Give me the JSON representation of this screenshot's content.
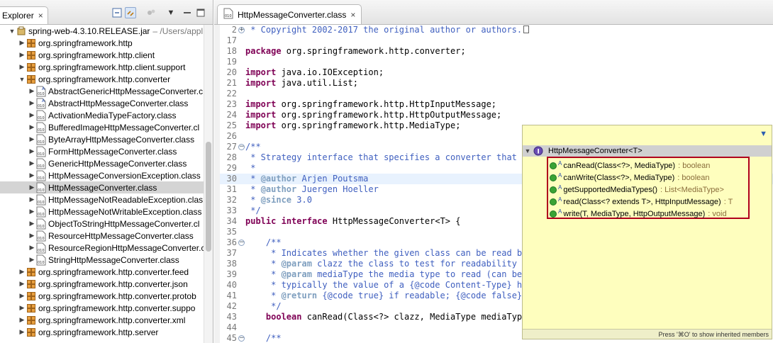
{
  "explorer": {
    "tab_label": "Explorer",
    "close_icon": "×",
    "items": [
      {
        "label": "spring-web-4.3.10.RELEASE.jar",
        "sub": "– /Users/appl",
        "kind": "jar",
        "indent": 1,
        "expanded": true
      },
      {
        "label": "org.springframework.http",
        "kind": "package",
        "indent": 2,
        "expanded": false
      },
      {
        "label": "org.springframework.http.client",
        "kind": "package",
        "indent": 2,
        "expanded": false
      },
      {
        "label": "org.springframework.http.client.support",
        "kind": "package",
        "indent": 2,
        "expanded": false
      },
      {
        "label": "org.springframework.http.converter",
        "kind": "package",
        "indent": 2,
        "expanded": true
      },
      {
        "label": "AbstractGenericHttpMessageConverter.c",
        "kind": "abstract-class",
        "indent": 3,
        "expanded": false
      },
      {
        "label": "AbstractHttpMessageConverter.class",
        "kind": "abstract-class",
        "indent": 3,
        "expanded": false
      },
      {
        "label": "ActivationMediaTypeFactory.class",
        "kind": "class",
        "indent": 3,
        "expanded": false
      },
      {
        "label": "BufferedImageHttpMessageConverter.cl",
        "kind": "class",
        "indent": 3,
        "expanded": false
      },
      {
        "label": "ByteArrayHttpMessageConverter.class",
        "kind": "class",
        "indent": 3,
        "expanded": false
      },
      {
        "label": "FormHttpMessageConverter.class",
        "kind": "class",
        "indent": 3,
        "expanded": false
      },
      {
        "label": "GenericHttpMessageConverter.class",
        "kind": "class",
        "indent": 3,
        "expanded": false
      },
      {
        "label": "HttpMessageConversionException.class",
        "kind": "class",
        "indent": 3,
        "expanded": false
      },
      {
        "label": "HttpMessageConverter.class",
        "kind": "class",
        "indent": 3,
        "expanded": false,
        "selected": true
      },
      {
        "label": "HttpMessageNotReadableException.clas",
        "kind": "class",
        "indent": 3,
        "expanded": false
      },
      {
        "label": "HttpMessageNotWritableException.class",
        "kind": "class",
        "indent": 3,
        "expanded": false
      },
      {
        "label": "ObjectToStringHttpMessageConverter.cl",
        "kind": "class",
        "indent": 3,
        "expanded": false
      },
      {
        "label": "ResourceHttpMessageConverter.class",
        "kind": "class",
        "indent": 3,
        "expanded": false
      },
      {
        "label": "ResourceRegionHttpMessageConverter.c",
        "kind": "class",
        "indent": 3,
        "expanded": false
      },
      {
        "label": "StringHttpMessageConverter.class",
        "kind": "class",
        "indent": 3,
        "expanded": false
      },
      {
        "label": "org.springframework.http.converter.feed",
        "kind": "package",
        "indent": 2,
        "expanded": false
      },
      {
        "label": "org.springframework.http.converter.json",
        "kind": "package",
        "indent": 2,
        "expanded": false
      },
      {
        "label": "org.springframework.http.converter.protob",
        "kind": "package",
        "indent": 2,
        "expanded": false
      },
      {
        "label": "org.springframework.http.converter.suppo",
        "kind": "package",
        "indent": 2,
        "expanded": false
      },
      {
        "label": "org.springframework.http.converter.xml",
        "kind": "package",
        "indent": 2,
        "expanded": false
      },
      {
        "label": "org.springframework.http.server",
        "kind": "package",
        "indent": 2,
        "expanded": false
      }
    ]
  },
  "editor": {
    "tab_label": "HttpMessageConverter.class",
    "close_icon": "×",
    "lines": [
      {
        "n": "2",
        "fold": "+",
        "segs": [
          {
            "t": " * Copyright 2002-2017 the original author or authors.",
            "c": "cm"
          }
        ],
        "box": true
      },
      {
        "n": "17",
        "segs": []
      },
      {
        "n": "18",
        "segs": [
          {
            "t": "package",
            "c": "kw"
          },
          {
            "t": " org.springframework.http.converter;"
          }
        ]
      },
      {
        "n": "19",
        "segs": []
      },
      {
        "n": "20",
        "segs": [
          {
            "t": "import",
            "c": "kw"
          },
          {
            "t": " java.io.IOException;"
          }
        ]
      },
      {
        "n": "21",
        "segs": [
          {
            "t": "import",
            "c": "kw"
          },
          {
            "t": " java.util.List;"
          }
        ]
      },
      {
        "n": "22",
        "segs": []
      },
      {
        "n": "23",
        "segs": [
          {
            "t": "import",
            "c": "kw"
          },
          {
            "t": " org.springframework.http.HttpInputMessage;"
          }
        ]
      },
      {
        "n": "24",
        "segs": [
          {
            "t": "import",
            "c": "kw"
          },
          {
            "t": " org.springframework.http.HttpOutputMessage;"
          }
        ]
      },
      {
        "n": "25",
        "segs": [
          {
            "t": "import",
            "c": "kw"
          },
          {
            "t": " org.springframework.http.MediaType;"
          }
        ]
      },
      {
        "n": "26",
        "segs": []
      },
      {
        "n": "27",
        "fold": "−",
        "segs": [
          {
            "t": "/**",
            "c": "cm"
          }
        ]
      },
      {
        "n": "28",
        "segs": [
          {
            "t": " * Strategy interface that specifies a converter that ca",
            "c": "cm"
          }
        ]
      },
      {
        "n": "29",
        "segs": [
          {
            "t": " *",
            "c": "cm"
          }
        ]
      },
      {
        "n": "30",
        "hl": true,
        "segs": [
          {
            "t": " * ",
            "c": "cm"
          },
          {
            "t": "@author",
            "c": "tag"
          },
          {
            "t": " Arjen Poutsma",
            "c": "cm"
          }
        ]
      },
      {
        "n": "31",
        "segs": [
          {
            "t": " * ",
            "c": "cm"
          },
          {
            "t": "@author",
            "c": "tag"
          },
          {
            "t": " Juergen Hoeller",
            "c": "cm"
          }
        ]
      },
      {
        "n": "32",
        "segs": [
          {
            "t": " * ",
            "c": "cm"
          },
          {
            "t": "@since",
            "c": "tag"
          },
          {
            "t": " 3.0",
            "c": "cm"
          }
        ]
      },
      {
        "n": "33",
        "segs": [
          {
            "t": " */",
            "c": "cm"
          }
        ]
      },
      {
        "n": "34",
        "segs": [
          {
            "t": "public",
            "c": "kw"
          },
          {
            "t": " "
          },
          {
            "t": "interface",
            "c": "kw"
          },
          {
            "t": " HttpMessageConverter<T> {"
          }
        ]
      },
      {
        "n": "35",
        "segs": []
      },
      {
        "n": "36",
        "fold": "−",
        "segs": [
          {
            "t": "    /**",
            "c": "cm"
          }
        ]
      },
      {
        "n": "37",
        "segs": [
          {
            "t": "     * Indicates whether the given class can be read by",
            "c": "cm"
          }
        ]
      },
      {
        "n": "38",
        "segs": [
          {
            "t": "     * ",
            "c": "cm"
          },
          {
            "t": "@param",
            "c": "tag"
          },
          {
            "t": " clazz the class to test for readability",
            "c": "cm"
          }
        ]
      },
      {
        "n": "39",
        "segs": [
          {
            "t": "     * ",
            "c": "cm"
          },
          {
            "t": "@param",
            "c": "tag"
          },
          {
            "t": " mediaType the media type to read (can be {",
            "c": "cm"
          }
        ]
      },
      {
        "n": "40",
        "segs": [
          {
            "t": "     * typically the value of a {@code Content-Type} hea",
            "c": "cm"
          }
        ]
      },
      {
        "n": "41",
        "segs": [
          {
            "t": "     * ",
            "c": "cm"
          },
          {
            "t": "@return",
            "c": "tag"
          },
          {
            "t": " {@code true} if readable; {@code false} o",
            "c": "cm"
          }
        ]
      },
      {
        "n": "42",
        "segs": [
          {
            "t": "     */",
            "c": "cm"
          }
        ]
      },
      {
        "n": "43",
        "segs": [
          {
            "t": "    "
          },
          {
            "t": "boolean",
            "c": "kw"
          },
          {
            "t": " canRead(Class<?> clazz, MediaType mediaType);"
          }
        ]
      },
      {
        "n": "44",
        "segs": []
      },
      {
        "n": "45",
        "fold": "−",
        "segs": [
          {
            "t": "    /**",
            "c": "cm"
          }
        ]
      }
    ]
  },
  "outline": {
    "menu_icon": "▼",
    "header": "HttpMessageConverter<T>",
    "items": [
      {
        "name": "canRead(Class<?>, MediaType)",
        "ret": ": boolean",
        "abstract": "A"
      },
      {
        "name": "canWrite(Class<?>, MediaType)",
        "ret": ": boolean",
        "abstract": "A"
      },
      {
        "name": "getSupportedMediaTypes()",
        "ret": ": List<MediaType>",
        "abstract": "A"
      },
      {
        "name": "read(Class<? extends T>, HttpInputMessage)",
        "ret": ": T",
        "abstract": "A"
      },
      {
        "name": "write(T, MediaType, HttpOutputMessage)",
        "ret": ": void",
        "abstract": "A"
      }
    ],
    "status": "Press '⌘O' to show inherited members"
  }
}
